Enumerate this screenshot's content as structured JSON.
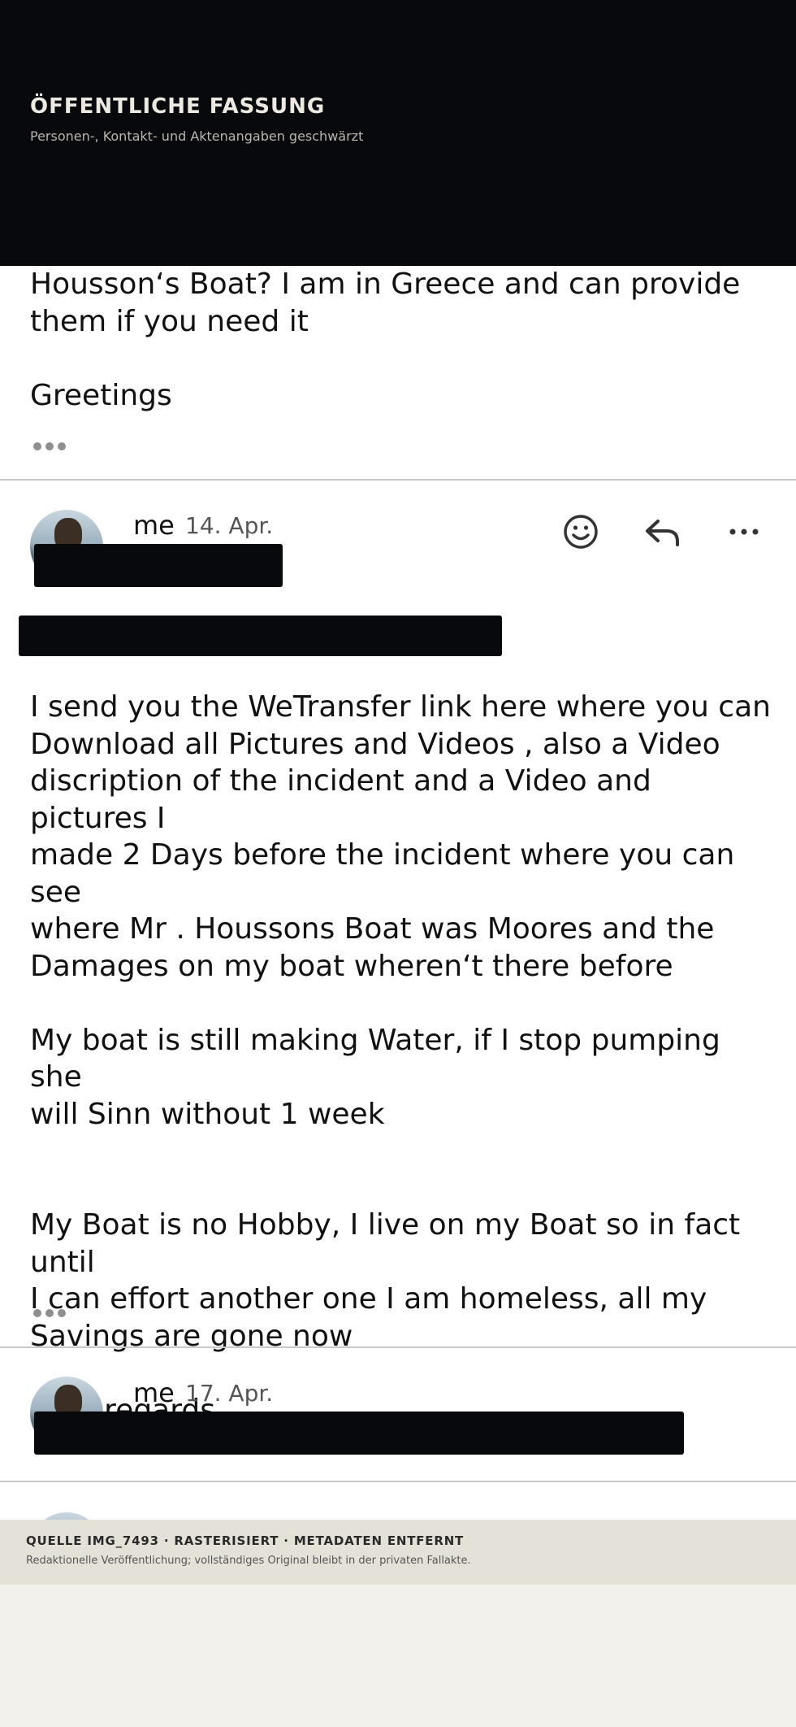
{
  "banner": {
    "title": "ÖFFENTLICHE FASSUNG",
    "subtitle": "Personen-, Kontakt- und Aktenangaben geschwärzt"
  },
  "messages": [
    {
      "text": "Housson‘s Boat? I am in Greece and can provide\nthem if you need it\n\nGreetings"
    },
    {
      "sender": "me",
      "date": "14. Apr.",
      "text": "I send you the WeTransfer link here where you can\nDownload all Pictures and Videos , also a Video\ndiscription of the incident and a Video and pictures I\nmade 2 Days before the incident where you can see\nwhere Mr . Houssons Boat was Moores and the\nDamages on my boat wheren‘t there before\n\nMy boat is still making Water, if I stop pumping she\nwill Sinn without 1 week\n\n\nMy Boat is no Hobby, I live on my Boat so in fact until\nI can effort another one I am homeless, all my\nSavings are gone now\n\nBest regards"
    },
    {
      "sender": "me",
      "date": "17. Apr."
    }
  ],
  "actions": {
    "emoji_icon": "smiley-icon",
    "reply_icon": "reply-arrow-icon",
    "more_icon": "more-dots-icon"
  },
  "footer": {
    "title": "QUELLE IMG_7493 · RASTERISIERT · METADATEN ENTFERNT",
    "subtitle": "Redaktionelle Veröffentlichung; vollständiges Original bleibt in der privaten Fallakte."
  },
  "colors": {
    "banner_bg": "#07090d",
    "redaction": "#07090d",
    "page_bg": "#f2f1eb",
    "footer_bg": "#e4e2d8"
  }
}
